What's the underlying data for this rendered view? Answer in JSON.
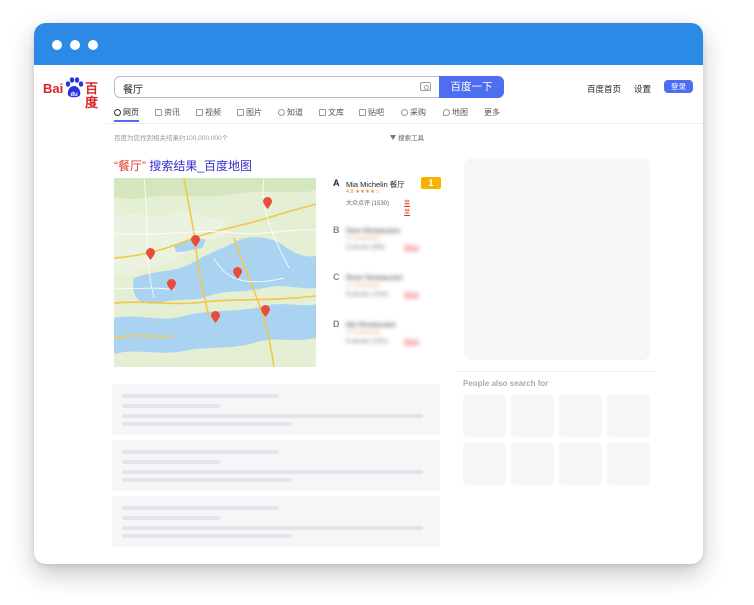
{
  "logo": {
    "bai": "Bai",
    "du": "百度",
    "paw_text": "du"
  },
  "search": {
    "query": "餐厅",
    "button_label": "百度一下"
  },
  "top_links": {
    "home": "百度首页",
    "settings": "设置",
    "login": "登录"
  },
  "tabs": [
    {
      "label": "网页",
      "icon": "search-icon"
    },
    {
      "label": "资讯",
      "icon": "news-icon"
    },
    {
      "label": "视频",
      "icon": "video-icon"
    },
    {
      "label": "图片",
      "icon": "image-icon"
    },
    {
      "label": "知道",
      "icon": "question-icon"
    },
    {
      "label": "文库",
      "icon": "document-icon"
    },
    {
      "label": "贴吧",
      "icon": "forum-icon"
    },
    {
      "label": "采购",
      "icon": "cart-icon"
    },
    {
      "label": "地图",
      "icon": "map-icon"
    },
    {
      "label": "更多",
      "icon": ""
    }
  ],
  "result_count": "百度为您找到相关结果约100,000,000个",
  "search_tools": "搜索工具",
  "result": {
    "title_open_quote": "“",
    "title_keyword": "餐厅",
    "title_close_quote": "”",
    "title_rest": " 搜索结果_百度地图"
  },
  "places": [
    {
      "letter": "A",
      "name": "Mia Michelin 餐厅",
      "rating": "4.8 ★★★★☆",
      "reviews": "大众点评 (1530)",
      "menu": "菜单",
      "badge": "1"
    },
    {
      "letter": "B",
      "name": "Dew Restaurant",
      "rating": "4.6 ★★★★★",
      "reviews": "Evaluate (580)",
      "menu": "Menu"
    },
    {
      "letter": "C",
      "name": "River Restaurant",
      "rating": "4.7 ★★★★★",
      "reviews": "Evaluate (1530)",
      "menu": "Menu"
    },
    {
      "letter": "D",
      "name": "Mo Restaurant",
      "rating": "4.9 ★★★★★",
      "reviews": "Evaluate (1551)",
      "menu": "Menu"
    }
  ],
  "people_also_search": "People also search for",
  "colors": {
    "accent": "#4e6ef2",
    "titlebar": "#2b8ae6",
    "logo_red": "#d6242b",
    "logo_blue": "#2932e1",
    "pin": "#e74c3c",
    "badge": "#f5b400"
  }
}
